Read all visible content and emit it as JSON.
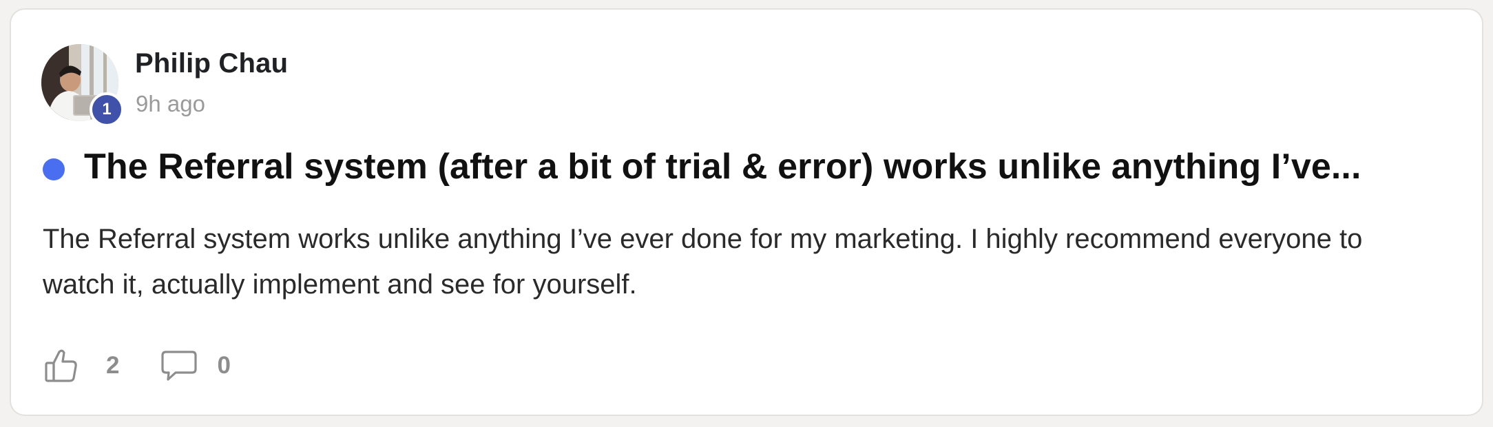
{
  "post": {
    "author": {
      "name": "Philip Chau",
      "level": "1",
      "avatar_icon": "user-photo"
    },
    "timestamp": "9h ago",
    "unread": true,
    "title": "The Referral system (after a bit of trial & error) works unlike anything I’ve...",
    "body": "The Referral system works unlike anything I’ve ever done for my marketing. I highly recommend everyone to watch it, actually implement and see for yourself.",
    "likes": "2",
    "comments": "0",
    "icons": {
      "like": "thumbs-up-icon",
      "comment": "comment-bubble-icon"
    },
    "colors": {
      "unread_dot": "#4a6ef0",
      "level_badge": "#3f51a8"
    }
  }
}
